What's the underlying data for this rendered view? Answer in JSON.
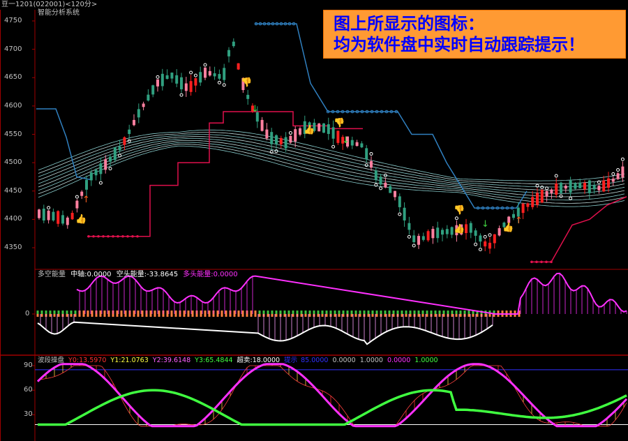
{
  "window": {
    "title": "豆一1201(022001)<120分>"
  },
  "colors": {
    "background": "#000000",
    "axis": "#a00000",
    "up_candle": "#ff2020",
    "down_candle": "#30a080",
    "ribbon": "#a0f0f0",
    "stop_up": "#e0104c",
    "stop_down": "#3080c0",
    "energy_positive": "#ff30ff",
    "energy_negative": "#ffffff",
    "banner_bg": "#ff9a33",
    "banner_text": "#0000ff"
  },
  "banner": {
    "line1": "图上所显示的图标：",
    "line2": "均为软件盘中实时自动跟踪提示！"
  },
  "main_panel": {
    "indicator_name": "智能分析系统",
    "y_ticks": [
      "4750",
      "4700",
      "4650",
      "4600",
      "4550",
      "4500",
      "4450",
      "4400",
      "4350"
    ]
  },
  "energy_panel": {
    "name": "多空能量",
    "center_label": "中轴:0.0000",
    "short_label": "空头能量:-33.8645",
    "long_label": "多头能量:0.0000",
    "zero_tick": "0"
  },
  "wave_panel": {
    "name": "波段操盘",
    "y0": "Y0:13.5970",
    "y1": "Y1:21.0763",
    "y2": "Y2:39.6148",
    "y3": "Y3:65.4844",
    "overbought": "超卖:18.0000",
    "alert_label": "提示",
    "v1": "85.0000",
    "v2": "0.0000",
    "v3": "1.0000",
    "v4": "0.0000",
    "v5": "1.0000",
    "y_ticks": [
      "90",
      "60",
      "30"
    ]
  },
  "icons": {
    "buy_signal": "thumbs-up-icon",
    "sell_signal": "thumbs-down-icon",
    "up_arrow": "up-arrow-icon",
    "down_arrow": "down-arrow-icon"
  }
}
